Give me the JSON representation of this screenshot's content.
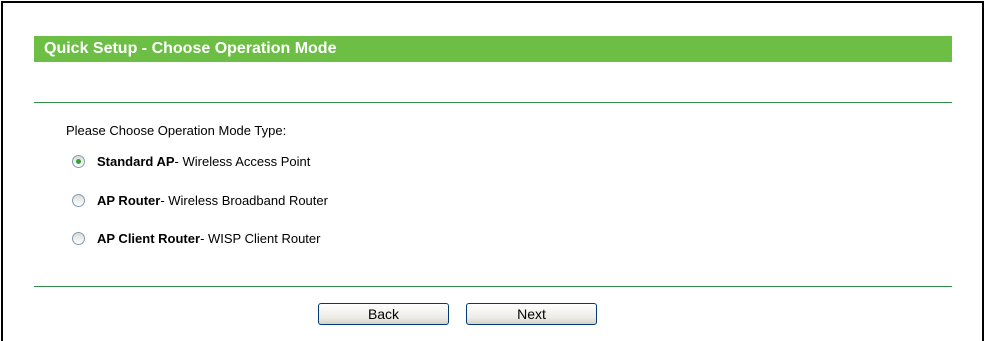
{
  "header": {
    "title": "Quick Setup - Choose Operation Mode",
    "accent_color": "#6cbf44"
  },
  "form": {
    "prompt": "Please Choose Operation Mode Type:",
    "options": [
      {
        "name": "Standard AP",
        "description": " - Wireless Access Point",
        "checked": true
      },
      {
        "name": "AP Router",
        "description": " - Wireless Broadband Router",
        "checked": false
      },
      {
        "name": "AP Client Router",
        "description": " - WISP Client Router",
        "checked": false
      }
    ]
  },
  "buttons": {
    "back_label": "Back",
    "next_label": "Next"
  }
}
